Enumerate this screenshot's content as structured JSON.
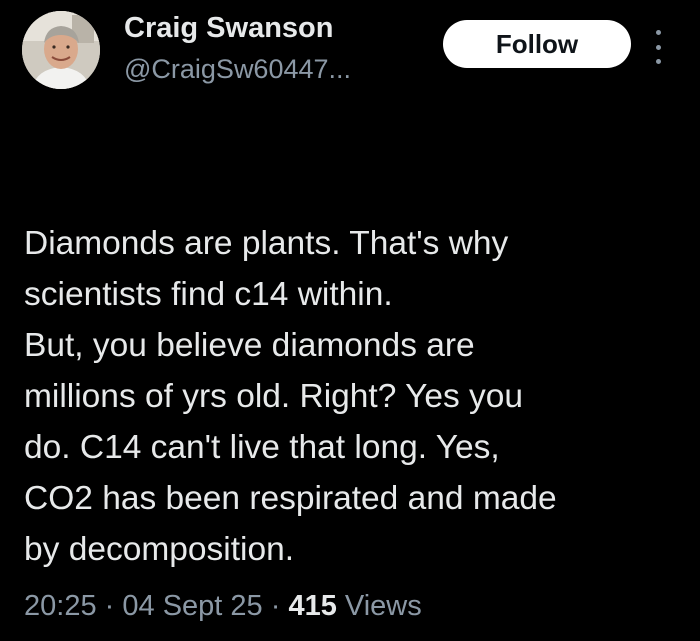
{
  "author": {
    "display_name": "Craig Swanson",
    "handle": "@CraigSw60447..."
  },
  "actions": {
    "follow_label": "Follow",
    "more_icon": "more-vertical-icon"
  },
  "tweet": {
    "lines": [
      "Diamonds are plants.  That's why",
      "scientists find c14 within.",
      "But, you believe diamonds are",
      "millions of yrs old.  Right?  Yes you",
      "do.  C14 can't live that long.  Yes,",
      "CO2 has been respirated and made",
      "by decomposition."
    ]
  },
  "meta": {
    "time": "20:25",
    "separator": "·",
    "date": "04 Sept 25",
    "views_count": "415",
    "views_label": "Views"
  },
  "colors": {
    "background": "#000000",
    "primary_text": "#e7e9ea",
    "secondary_text": "#8b98a5",
    "follow_bg": "#ffffff",
    "follow_text": "#0f1419"
  }
}
